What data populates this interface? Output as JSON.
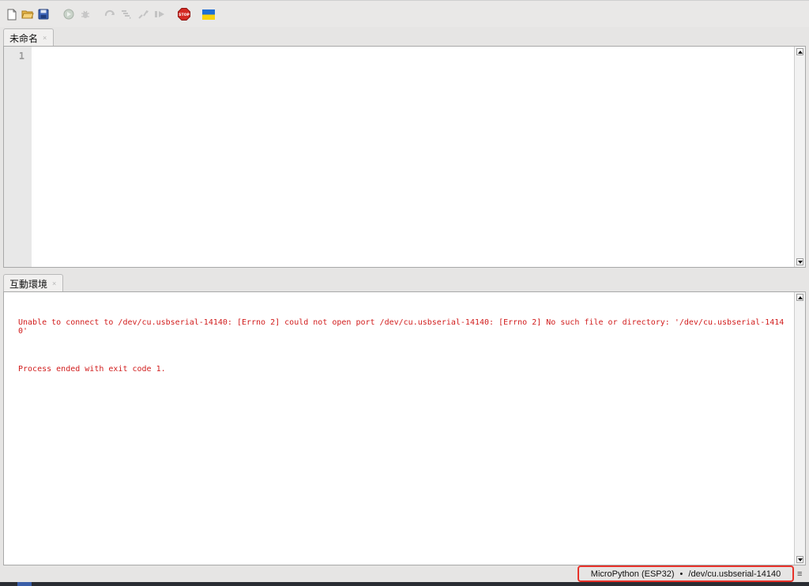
{
  "toolbar": {
    "buttons": [
      {
        "name": "new-file",
        "icon": "new-file-icon"
      },
      {
        "name": "open-file",
        "icon": "folder-open-icon"
      },
      {
        "name": "save-file",
        "icon": "save-icon"
      },
      {
        "name": "run",
        "icon": "run-icon"
      },
      {
        "name": "debug",
        "icon": "bug-icon"
      },
      {
        "name": "step-over",
        "icon": "step-over-icon"
      },
      {
        "name": "step-into",
        "icon": "step-into-icon"
      },
      {
        "name": "step-out",
        "icon": "step-out-icon"
      },
      {
        "name": "resume",
        "icon": "resume-icon"
      },
      {
        "name": "stop",
        "icon": "stop-icon",
        "label": "STOP"
      },
      {
        "name": "ukraine",
        "icon": "ukraine-flag-icon"
      }
    ],
    "stop_label": "STOP"
  },
  "editor": {
    "tab_label": "未命名",
    "tab_close": "×",
    "line_numbers": [
      "1"
    ]
  },
  "shell": {
    "tab_label": "互動環境",
    "tab_close": "×",
    "error_text": "Unable to connect to /dev/cu.usbserial-14140: [Errno 2] could not open port /dev/cu.usbserial-14140: [Errno 2] No such file or directory: '/dev/cu.usbserial-14140'",
    "exit_text": "Process ended with exit code 1."
  },
  "statusbar": {
    "interpreter": "MicroPython (ESP32)",
    "separator": "•",
    "port": "/dev/cu.usbserial-14140",
    "menu_glyph": "≡"
  },
  "colors": {
    "error_text": "#d11c1c",
    "highlight_border": "#e8322a"
  }
}
